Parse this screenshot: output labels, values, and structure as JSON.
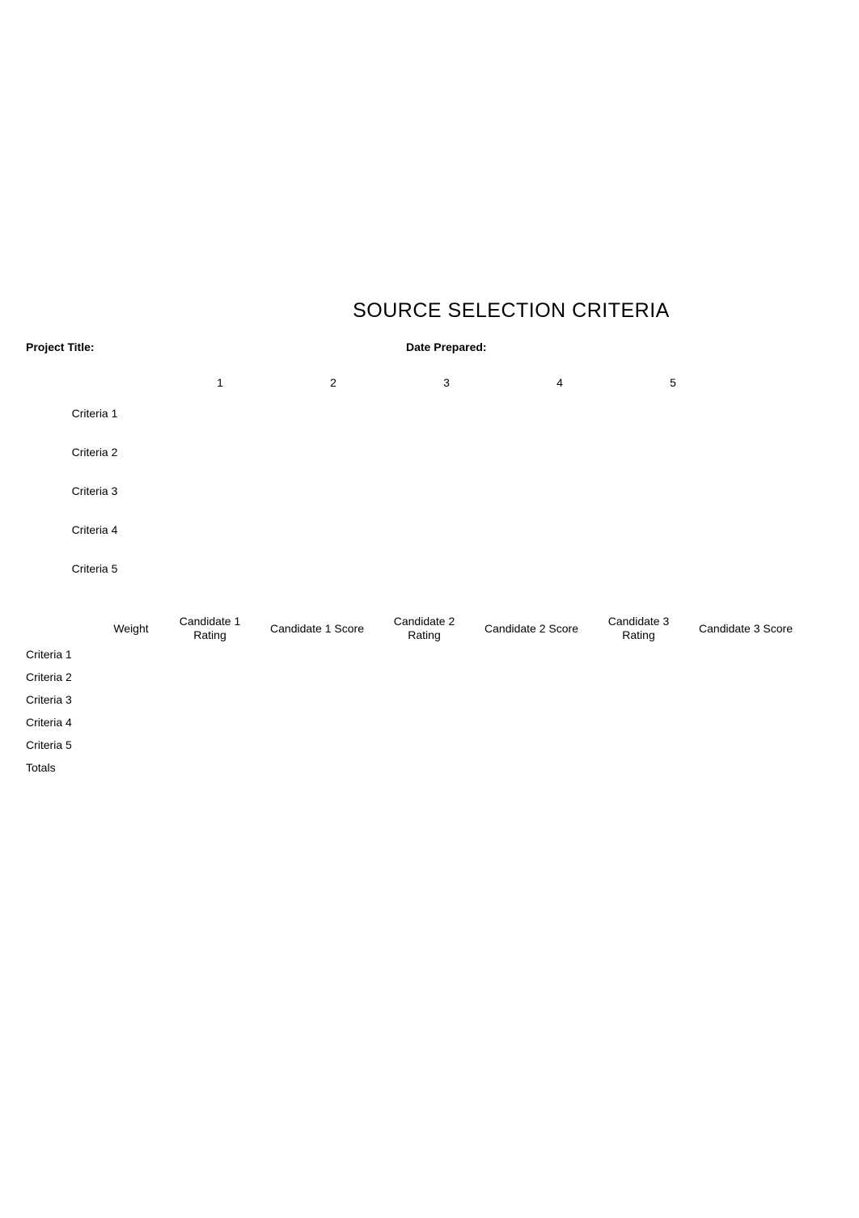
{
  "title": "SOURCE SELECTION CRITERIA",
  "labels": {
    "project_title": "Project Title:",
    "date_prepared": "Date Prepared:"
  },
  "criteria_table": {
    "headers": [
      "1",
      "2",
      "3",
      "4",
      "5"
    ],
    "rows": [
      {
        "label": "Criteria 1"
      },
      {
        "label": "Criteria 2"
      },
      {
        "label": "Criteria 3"
      },
      {
        "label": "Criteria 4"
      },
      {
        "label": "Criteria 5"
      }
    ]
  },
  "scoring_table": {
    "headers": {
      "blank": "",
      "weight": "Weight",
      "c1_rating": "Candidate 1\nRating",
      "c1_score": "Candidate 1 Score",
      "c2_rating": "Candidate 2\nRating",
      "c2_score": "Candidate 2 Score",
      "c3_rating": "Candidate 3\nRating",
      "c3_score": "Candidate 3 Score"
    },
    "rows": [
      {
        "label": "Criteria 1"
      },
      {
        "label": "Criteria 2"
      },
      {
        "label": "Criteria 3"
      },
      {
        "label": "Criteria 4"
      },
      {
        "label": "Criteria 5"
      },
      {
        "label": "Totals"
      }
    ]
  }
}
